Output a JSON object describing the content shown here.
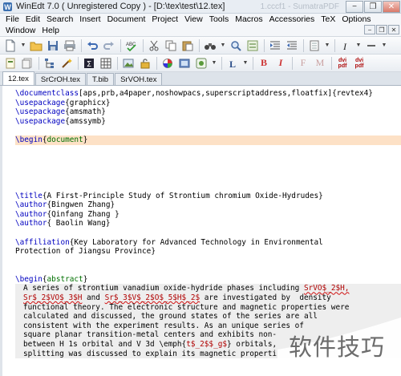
{
  "window": {
    "title": "WinEdt 7.0  ( Unregistered  Copy )  - [D:\\tex\\test\\12.tex]",
    "background_ghost": "1.cccf1 - SumatraPDF",
    "buttons": [
      "−",
      "❐",
      "✕"
    ]
  },
  "menu": {
    "row1": [
      "File",
      "Edit",
      "Search",
      "Insert",
      "Document",
      "Project",
      "View",
      "Tools",
      "Macros",
      "Accessories",
      "TeX",
      "Options"
    ],
    "row2": [
      "Window",
      "Help"
    ],
    "mdi_buttons": [
      "−",
      "❐",
      "✕"
    ]
  },
  "toolbar1": {
    "icons": [
      "new-file-icon",
      "open-folder-icon",
      "save-icon",
      "print-icon",
      "undo-icon",
      "redo-icon",
      "spellcheck-icon",
      "cut-icon",
      "copy-icon",
      "paste-icon",
      "find-icon",
      "replace-icon",
      "binoculars-icon",
      "indent-icon",
      "outdent-icon",
      "comment-icon",
      "uncomment-icon",
      "bookmark-icon",
      "italic-macro-icon",
      "dash-icon"
    ]
  },
  "toolbar2": {
    "icons": [
      "page-icon",
      "pages-icon",
      "tree-icon",
      "wizard-icon",
      "sigma-icon",
      "table-icon",
      "graphics-icon",
      "unlock-icon",
      "color-icon",
      "frame-icon",
      "diagram-icon",
      "label-icon"
    ],
    "format_labels": {
      "bold": "B",
      "italic": "I",
      "font": "F",
      "math": "M",
      "dvi_pdf": "dvi pdf",
      "pdf": "dvi pdf"
    }
  },
  "tabs": [
    {
      "label": "12.tex",
      "active": true
    },
    {
      "label": "SrCrOH.tex",
      "active": false
    },
    {
      "label": "T.bib",
      "active": false
    },
    {
      "label": "SrVOH.tex",
      "active": false
    }
  ],
  "code": {
    "documentclass_cmd": "\\documentclass",
    "documentclass_opts": "[aps,prb,a4paper,noshowpacs,superscriptaddress,floatfix]",
    "documentclass_arg": "{revtex4}",
    "usepackage": "\\usepackage",
    "pkg1": "{graphicx}",
    "pkg2": "{amsmath}",
    "pkg3": "{amssymb}",
    "begin_cmd": "\\begin",
    "begin_doc": "document",
    "title_cmd": "\\title",
    "title_arg": "{A First-Principle Study of Strontium chromium Oxide-Hydrudes}",
    "author_cmd": "\\author",
    "author1": "{Bingwen Zhang}",
    "author2": "{Qinfang Zhang }",
    "author3": "{ Baolin Wang}",
    "affil_cmd": "\\affiliation",
    "affil_line1": "{Key Laboratory for Advanced Technology in Environmental",
    "affil_line2": "Protection of Jiangsu Province}",
    "begin_abstract": "abstract",
    "abs1a": "A series of strontium vanadium oxide-hydride phases including ",
    "abs1b": "SrVO$_2$H,",
    "abs2a": "Sr$_2$VO$_3$H",
    "abs2b": " and ",
    "abs2c": "Sr$_3$V$_2$O$_5$H$_2$",
    "abs2d": " are investigated by  density",
    "abs3": "functional theory. The electronic structure and magnetic properties were",
    "abs4": "calculated and discussed, the ground states of the series are all",
    "abs5": "consistent with the experiment results. As an unique series of",
    "abs6": "square planar transition-metal centers and exhibits non-",
    "abs7a": "between H 1s orbital and V 3d \\emph{",
    "abs7b": "t$_2$$_g$",
    "abs7c": "} orbitals, ",
    "abs8": "splitting was discussed to explain its magnetic properti"
  },
  "watermark": {
    "text": "软件技巧"
  }
}
